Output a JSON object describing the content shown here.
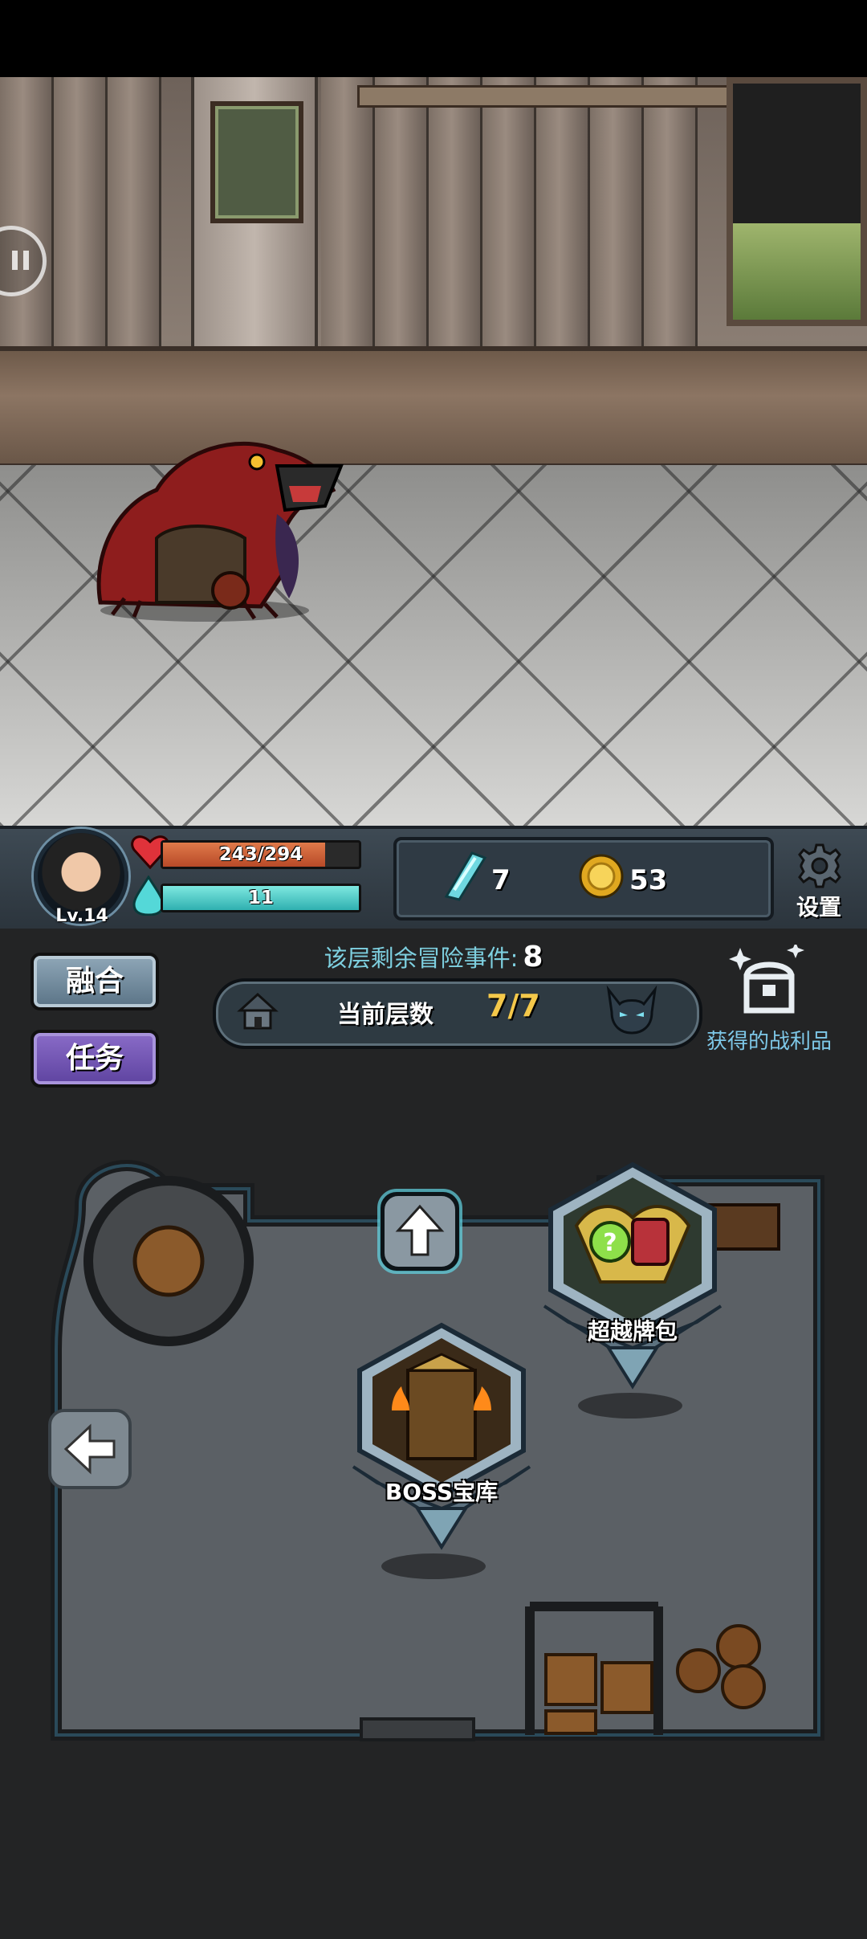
{
  "player": {
    "level": "Lv.14",
    "hp_text": "243/294",
    "hp_fraction": 0.827,
    "mp_text": "11",
    "mp_fraction": 1.0
  },
  "currency": {
    "crystals": "7",
    "coins": "53"
  },
  "settings_label": "设置",
  "side_buttons": {
    "merge": "融合",
    "task": "任务"
  },
  "events": {
    "label": "该层剩余冒险事件:",
    "count": "8"
  },
  "floor": {
    "label": "当前层数",
    "value": "7/7"
  },
  "loot_label": "获得的战利品",
  "map_nodes": {
    "boss_vault": "BOSS宝库",
    "super_pack": "超越牌包"
  },
  "colors": {
    "hp": "#c8552e",
    "mp": "#45c4c4",
    "floor_value": "#f4c84a",
    "events_label": "#7ed0e0",
    "loot_label": "#7ec8e8"
  },
  "icons": [
    "pause-icon",
    "heart-icon",
    "mana-drop-icon",
    "crystal-icon",
    "coin-icon",
    "gear-icon",
    "house-icon",
    "demon-icon",
    "treasure-chest-icon",
    "up-arrow-icon",
    "back-arrow-icon"
  ]
}
